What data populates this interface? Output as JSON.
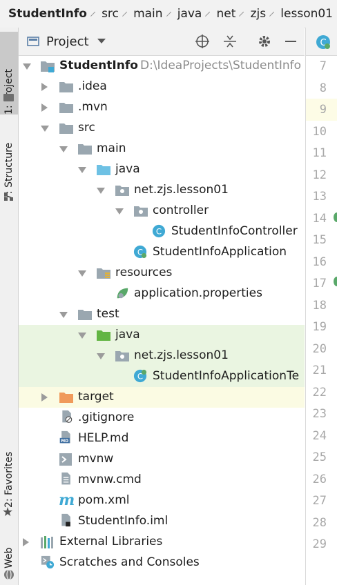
{
  "breadcrumb": [
    "StudentInfo",
    "src",
    "main",
    "java",
    "net",
    "zjs",
    "lesson01"
  ],
  "left_strip": {
    "project_tab": "1: Project",
    "structure_tab": "7: Structure",
    "favorites_tab": "2: Favorites",
    "web_tab": "Web"
  },
  "project_panel": {
    "title": "Project"
  },
  "tree": [
    {
      "label": "StudentInfo",
      "extra": "D:\\IdeaProjects\\StudentInfo",
      "icon": "module-folder-icon",
      "expanded": true,
      "bold": true
    },
    {
      "label": ".idea",
      "icon": "folder-icon",
      "expanded": false
    },
    {
      "label": ".mvn",
      "icon": "folder-icon",
      "expanded": false
    },
    {
      "label": "src",
      "icon": "folder-icon",
      "expanded": true
    },
    {
      "label": "main",
      "icon": "folder-icon",
      "expanded": true
    },
    {
      "label": "java",
      "icon": "source-folder-icon",
      "expanded": true
    },
    {
      "label": "net.zjs.lesson01",
      "icon": "package-icon",
      "expanded": true
    },
    {
      "label": "controller",
      "icon": "package-icon",
      "expanded": true
    },
    {
      "label": "StudentInfoController",
      "icon": "class-icon"
    },
    {
      "label": "StudentInfoApplication",
      "icon": "spring-boot-class-icon"
    },
    {
      "label": "resources",
      "icon": "resources-folder-icon",
      "expanded": true
    },
    {
      "label": "application.properties",
      "icon": "spring-properties-icon"
    },
    {
      "label": "test",
      "icon": "folder-icon",
      "expanded": true
    },
    {
      "label": "java",
      "icon": "test-source-folder-icon",
      "expanded": true
    },
    {
      "label": "net.zjs.lesson01",
      "icon": "package-icon",
      "expanded": true
    },
    {
      "label": "StudentInfoApplicationTe",
      "icon": "spring-boot-class-icon"
    },
    {
      "label": "target",
      "icon": "excluded-folder-icon",
      "expanded": false
    },
    {
      "label": ".gitignore",
      "icon": "gitignore-file-icon"
    },
    {
      "label": "HELP.md",
      "icon": "markdown-file-icon"
    },
    {
      "label": "mvnw",
      "icon": "shell-script-icon"
    },
    {
      "label": "mvnw.cmd",
      "icon": "text-file-icon"
    },
    {
      "label": "pom.xml",
      "icon": "maven-file-icon"
    },
    {
      "label": "StudentInfo.iml",
      "icon": "iml-file-icon"
    },
    {
      "label": "External Libraries",
      "icon": "libraries-icon",
      "expanded": false
    },
    {
      "label": "Scratches and Consoles",
      "icon": "scratches-icon"
    }
  ],
  "editor": {
    "line_numbers": [
      "7",
      "8",
      "9",
      "10",
      "11",
      "12",
      "13",
      "14",
      "15",
      "16",
      "17",
      "18",
      "19",
      "20",
      "21",
      "22",
      "23",
      "24",
      "25",
      "26",
      "27",
      "28",
      "29"
    ]
  },
  "colors": {
    "test_highlight": "#eaf5e1",
    "target_highlight": "#fbfbe3",
    "class_blue": "#3fa9d4",
    "spring_green": "#59a869",
    "folder_gray": "#9aa7b0",
    "excluded_orange": "#f09a5b"
  }
}
